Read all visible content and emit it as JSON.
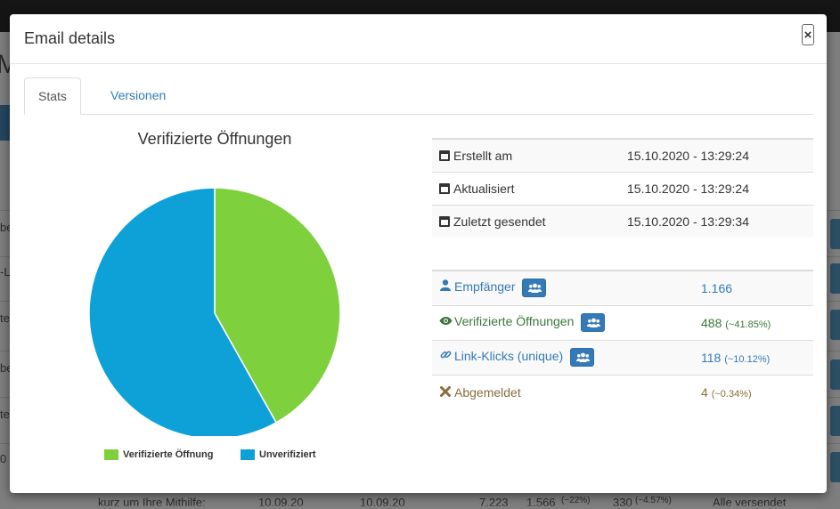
{
  "modal": {
    "title": "Email details",
    "close_label": "×"
  },
  "tabs": [
    {
      "label": "Stats",
      "active": true
    },
    {
      "label": "Versionen",
      "active": false
    }
  ],
  "chart_data": {
    "type": "pie",
    "title": "Verifizierte Öffnungen",
    "categories": [
      "Verifizierte Öffnung",
      "Unverifiziert"
    ],
    "values": [
      41.85,
      58.15
    ],
    "colors": [
      "#7ed03c",
      "#0ea1d8"
    ],
    "legend_position": "bottom"
  },
  "info": {
    "rows": [
      {
        "icon": "calendar-icon",
        "label": "Erstellt am",
        "value": "15.10.2020 - 13:29:24"
      },
      {
        "icon": "calendar-icon",
        "label": "Aktualisiert",
        "value": "15.10.2020 - 13:29:24"
      },
      {
        "icon": "calendar-icon",
        "label": "Zuletzt gesendet",
        "value": "15.10.2020 - 13:29:34"
      }
    ]
  },
  "stats": {
    "rows": [
      {
        "icon": "user-icon",
        "label": "Empfänger",
        "value": "1.166",
        "pct": "",
        "color": "#337ab7"
      },
      {
        "icon": "eye-icon",
        "label": "Verifizierte Öffnungen",
        "value": "488",
        "pct": "(~41.85%)",
        "color": "#3c763d"
      },
      {
        "icon": "link-icon",
        "label": "Link-Klicks (unique)",
        "value": "118",
        "pct": "(~10.12%)",
        "color": "#337ab7"
      },
      {
        "icon": "x-icon",
        "label": "Abgemeldet",
        "value": "4",
        "pct": "(~0.34%)",
        "color": "#8a6d3b"
      }
    ]
  },
  "background": {
    "title_letter": "M",
    "row_snippets": [
      "be",
      "-La",
      "te",
      "be",
      "te",
      "0"
    ],
    "bottom_row": {
      "subject": "kurz um Ihre Mithilfe:",
      "date1": "10.09.20",
      "date2": "10.09.20",
      "recipients": "7.223",
      "opens": "1.566",
      "opens_pct": "(~22%)",
      "clicks": "330",
      "clicks_pct": "(~4.57%)",
      "status": "Alle versendet"
    }
  }
}
